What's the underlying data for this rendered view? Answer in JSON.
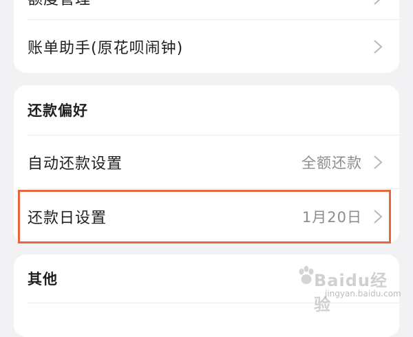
{
  "top_card": {
    "partial_item_label": "额度管理",
    "bill_assistant_label": "账单助手(原花呗闹钟)"
  },
  "repayment_card": {
    "title": "还款偏好",
    "auto_repay": {
      "label": "自动还款设置",
      "value": "全额还款"
    },
    "repay_day": {
      "label": "还款日设置",
      "value": "1月20日"
    }
  },
  "other_card": {
    "title": "其他"
  },
  "watermark": {
    "brand": "Baidu经验",
    "url": "jingyan.baidu.com"
  },
  "icons": {
    "row_arrow": "chevron-right-icon",
    "watermark_logo": "baidu-paw-icon"
  },
  "colors": {
    "highlight_border": "#e8663d",
    "background": "#f2f2f4",
    "card": "#ffffff",
    "secondary_text": "#8c8c8c"
  }
}
